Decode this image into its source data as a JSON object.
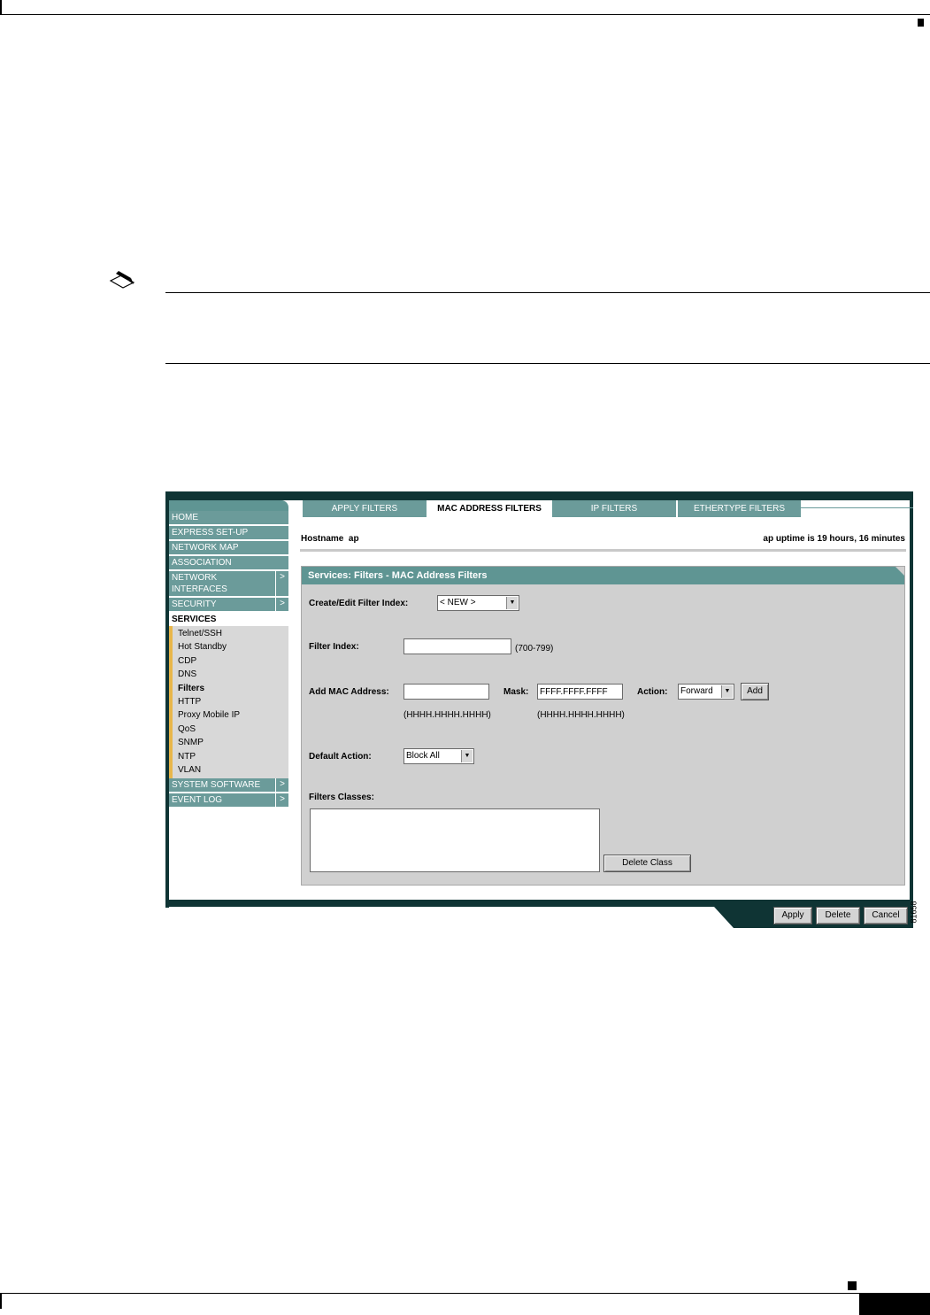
{
  "nav": {
    "items": [
      {
        "label": "HOME",
        "arrow": ""
      },
      {
        "label": "EXPRESS SET-UP",
        "arrow": ""
      },
      {
        "label": "NETWORK MAP",
        "arrow": ""
      },
      {
        "label": "ASSOCIATION",
        "arrow": ""
      },
      {
        "label": "NETWORK INTERFACES",
        "arrow": ">"
      },
      {
        "label": "SECURITY",
        "arrow": ">"
      }
    ],
    "active": "SERVICES",
    "sub_items": [
      "Telnet/SSH",
      "Hot Standby",
      "CDP",
      "DNS",
      "Filters",
      "HTTP",
      "Proxy Mobile IP",
      "QoS",
      "SNMP",
      "NTP",
      "VLAN"
    ],
    "bottom_items": [
      {
        "label": "SYSTEM SOFTWARE",
        "arrow": ">"
      },
      {
        "label": "EVENT LOG",
        "arrow": ">"
      }
    ]
  },
  "tabs": [
    "APPLY FILTERS",
    "MAC ADDRESS FILTERS",
    "IP FILTERS",
    "ETHERTYPE FILTERS"
  ],
  "header": {
    "hostname": "Hostname  ap",
    "uptime": "ap uptime is 19 hours, 16 minutes"
  },
  "panel": {
    "title": "Services: Filters - MAC Address Filters",
    "create_label": "Create/Edit Filter Index:",
    "create_value": "< NEW >",
    "filter_index_label": "Filter Index:",
    "filter_index_value": "",
    "filter_index_hint": "(700-799)",
    "mac_label": "Add MAC Address:",
    "mac_value": "",
    "mac_hint": "(HHHH.HHHH.HHHH)",
    "mask_label": "Mask:",
    "mask_value": "FFFF.FFFF.FFFF",
    "mask_hint": "(HHHH.HHHH.HHHH)",
    "action_label": "Action:",
    "action_value": "Forward",
    "add_button": "Add",
    "default_action_label": "Default Action:",
    "default_action_value": "Block All",
    "filters_classes_label": "Filters Classes:",
    "delete_class_button": "Delete Class"
  },
  "footer_buttons": [
    "Apply",
    "Delete",
    "Cancel"
  ],
  "figure_id": "81658",
  "colors": {
    "teal": "#6b9b9a",
    "dark_teal": "#0f3434",
    "panel_gray": "#d0d0d0",
    "accent_yellow": "#e8b64a"
  }
}
